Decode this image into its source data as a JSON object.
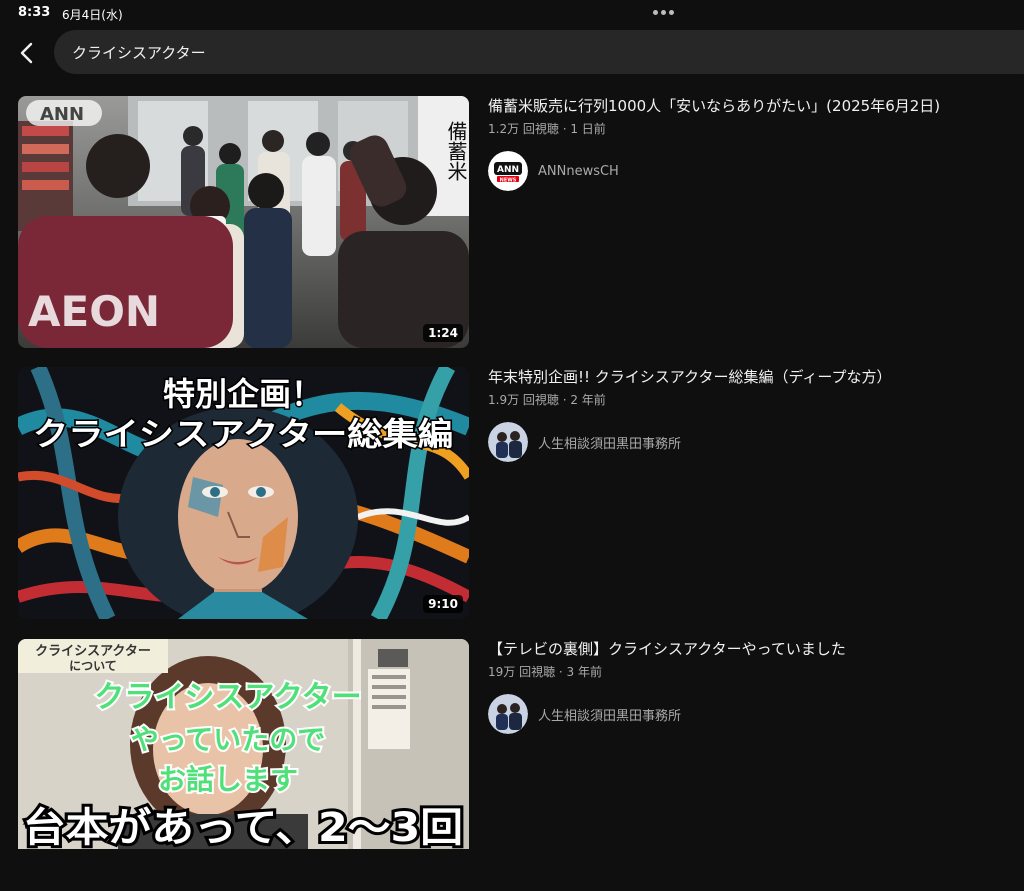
{
  "status_bar": {
    "time": "8:33",
    "date": "6月4日(水)"
  },
  "search": {
    "query": "クライシスアクター"
  },
  "results": [
    {
      "title": "備蓄米販売に行列1000人「安いならありがたい」(2025年6月2日)",
      "views": "1.2万 回視聴 · 1 日前",
      "channel": "ANNnewsCH",
      "duration": "1:24",
      "thumbnail_icon": "news-store-crowd-thumbnail"
    },
    {
      "title": "年末特別企画!! クライシスアクター総集編（ディープな方）",
      "views": "1.9万 回視聴 · 2 年前",
      "channel": "人生相談須田黒田事務所",
      "duration": "9:10",
      "thumbnail_icon": "painted-face-thumbnail",
      "thumbnail_text": [
        "特別企画！",
        "クライシスアクター総集編"
      ]
    },
    {
      "title": "【テレビの裏側】クライシスアクターやっていました",
      "views": "19万 回視聴 · 3 年前",
      "channel": "人生相談須田黒田事務所",
      "thumbnail_icon": "woman-talking-thumbnail",
      "thumbnail_text": [
        "クライシスアクター",
        "について",
        "クライシスアクター",
        "やっていたので",
        "お話します",
        "台本があって、2〜3回"
      ]
    }
  ],
  "logos": {
    "ann_tag": "ANN",
    "ann_badge": "ANN",
    "news_badge": "NEWS",
    "aeon": "AEON",
    "sign": "備蓄米"
  },
  "colors": {
    "background": "#0f0f0f",
    "search_field": "#272727",
    "secondary_text": "#aaaaaa"
  }
}
